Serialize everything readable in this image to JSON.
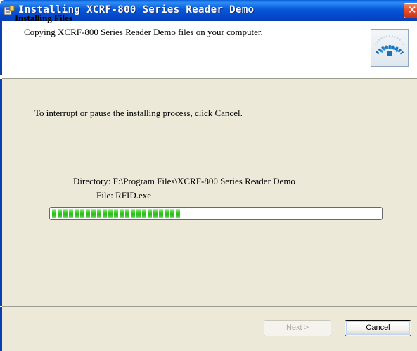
{
  "window": {
    "title": "Installing XCRF-800 Series Reader Demo",
    "icon": "installer-icon",
    "close_label": "✕"
  },
  "header": {
    "title": "Installing Files",
    "description": "Copying XCRF-800 Series Reader Demo files on your computer.",
    "logo_icon": "installer-disc-icon"
  },
  "body": {
    "instruction": "To interrupt or pause the installing process, click Cancel.",
    "directory_label": "Directory: F:\\Program Files\\XCRF-800 Series Reader Demo",
    "file_label": "File: RFID.exe",
    "progress_fraction": 0.39
  },
  "footer": {
    "next_label": "Next >",
    "next_enabled": false,
    "cancel_label": "Cancel"
  },
  "colors": {
    "titlebar": "#0758d8",
    "dialog_bg": "#ece9d8",
    "progress_fill": "#27b91a",
    "close_button": "#e5502a"
  }
}
